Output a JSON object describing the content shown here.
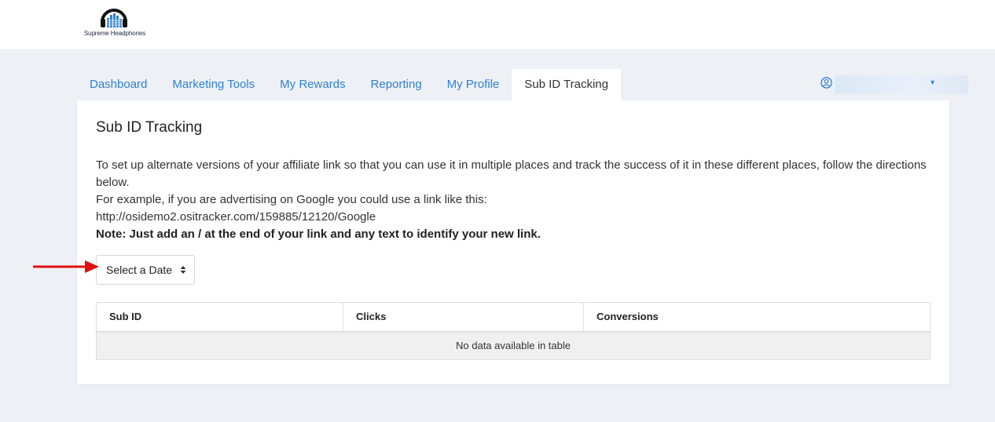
{
  "brand": {
    "name": "Supreme Headphones",
    "logo_icon": "headphones-logo-icon"
  },
  "nav": {
    "tabs": [
      {
        "label": "Dashboard"
      },
      {
        "label": "Marketing Tools"
      },
      {
        "label": "My Rewards"
      },
      {
        "label": "Reporting"
      },
      {
        "label": "My Profile"
      },
      {
        "label": "Sub ID Tracking",
        "active": true
      }
    ],
    "user_icon": "user-circle-icon"
  },
  "page": {
    "title": "Sub ID Tracking",
    "intro": "To set up alternate versions of your affiliate link so that you can use it in multiple places and track the success of it in these different places, follow the directions below.",
    "example_intro": "For example, if you are advertising on Google you could use a link like this:",
    "example_link": "http://osidemo2.ositracker.com/159885/12120/Google",
    "note": "Note: Just add an / at the end of your link and any text to identify your new link."
  },
  "date_select": {
    "label": "Select a Date"
  },
  "table": {
    "columns": [
      "Sub ID",
      "Clicks",
      "Conversions"
    ],
    "empty_message": "No data available in table"
  },
  "colors": {
    "accent": "#2f7fd6",
    "background": "#edf1f5",
    "arrow": "#e01010"
  }
}
